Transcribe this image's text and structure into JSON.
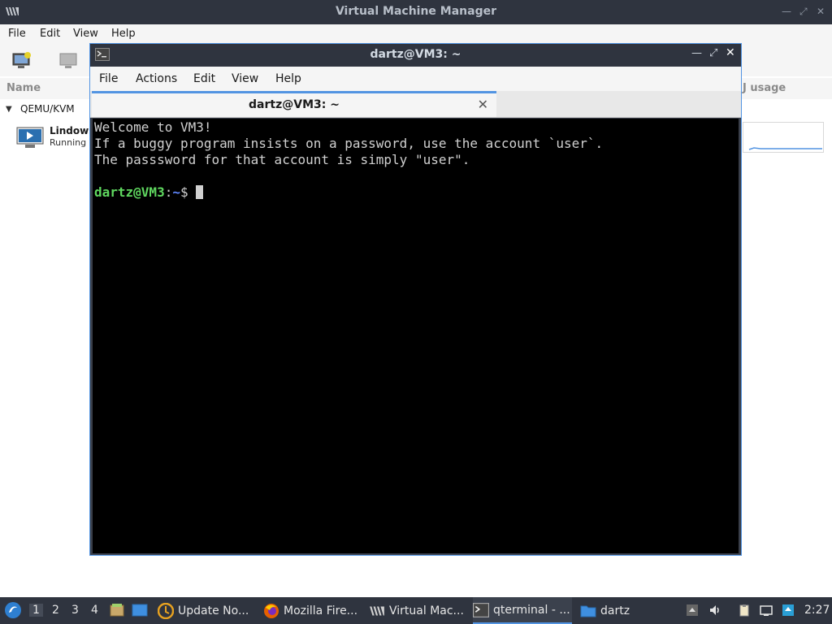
{
  "vmm": {
    "title": "Virtual Machine Manager",
    "menu": [
      "File",
      "Edit",
      "View",
      "Help"
    ],
    "column_name": "Name",
    "column_cpu_usage": "J usage",
    "group": "QEMU/KVM",
    "vm_name": "Lindows",
    "vm_status": "Running"
  },
  "terminal": {
    "title": "dartz@VM3: ~",
    "menu": [
      "File",
      "Actions",
      "Edit",
      "View",
      "Help"
    ],
    "tab_label": "dartz@VM3: ~",
    "lines": [
      "Welcome to VM3!",
      "If a buggy program insists on a password, use the account `user`.",
      "The passsword for that account is simply \"user\"."
    ],
    "prompt_user": "dartz@VM3",
    "prompt_sep": ":",
    "prompt_path": "~",
    "prompt_symbol": "$"
  },
  "taskbar": {
    "workspaces": [
      "1",
      "2",
      "3",
      "4"
    ],
    "tasks": [
      {
        "label": "Update No...",
        "icon": "update-notifier-icon"
      },
      {
        "label": "Mozilla Fire...",
        "icon": "firefox-icon"
      },
      {
        "label": "Virtual Mac...",
        "icon": "virt-manager-icon"
      },
      {
        "label": "qterminal - ...",
        "icon": "terminal-icon"
      },
      {
        "label": "dartz",
        "icon": "folder-icon"
      }
    ],
    "clock": "2:27"
  },
  "colors": {
    "accent": "#5294e2",
    "titlebar": "#2f343f",
    "prompt_user": "#5fd75f",
    "prompt_path": "#5f87ff"
  }
}
